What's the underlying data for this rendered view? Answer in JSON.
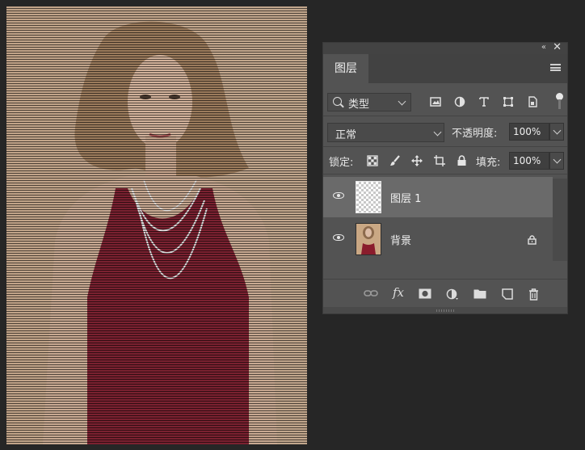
{
  "panel": {
    "tab_label": "图层",
    "filter": {
      "label": "类型"
    },
    "blend_mode": "正常",
    "opacity_label": "不透明度:",
    "opacity_value": "100%",
    "lock_label": "锁定:",
    "fill_label": "填充:",
    "fill_value": "100%",
    "layers": [
      {
        "name": "图层 1",
        "selected": true,
        "thumbnail": "transparent"
      },
      {
        "name": "背景",
        "selected": false,
        "thumbnail": "photo",
        "locked": true
      }
    ]
  },
  "bottom_icons": [
    "link-icon",
    "fx-icon",
    "mask-icon",
    "adjustment-icon",
    "folder-icon",
    "new-layer-icon",
    "trash-icon"
  ],
  "colors": {
    "panel_bg": "#535353",
    "selected_row": "#6a6a6a",
    "workspace_bg": "#262626"
  }
}
